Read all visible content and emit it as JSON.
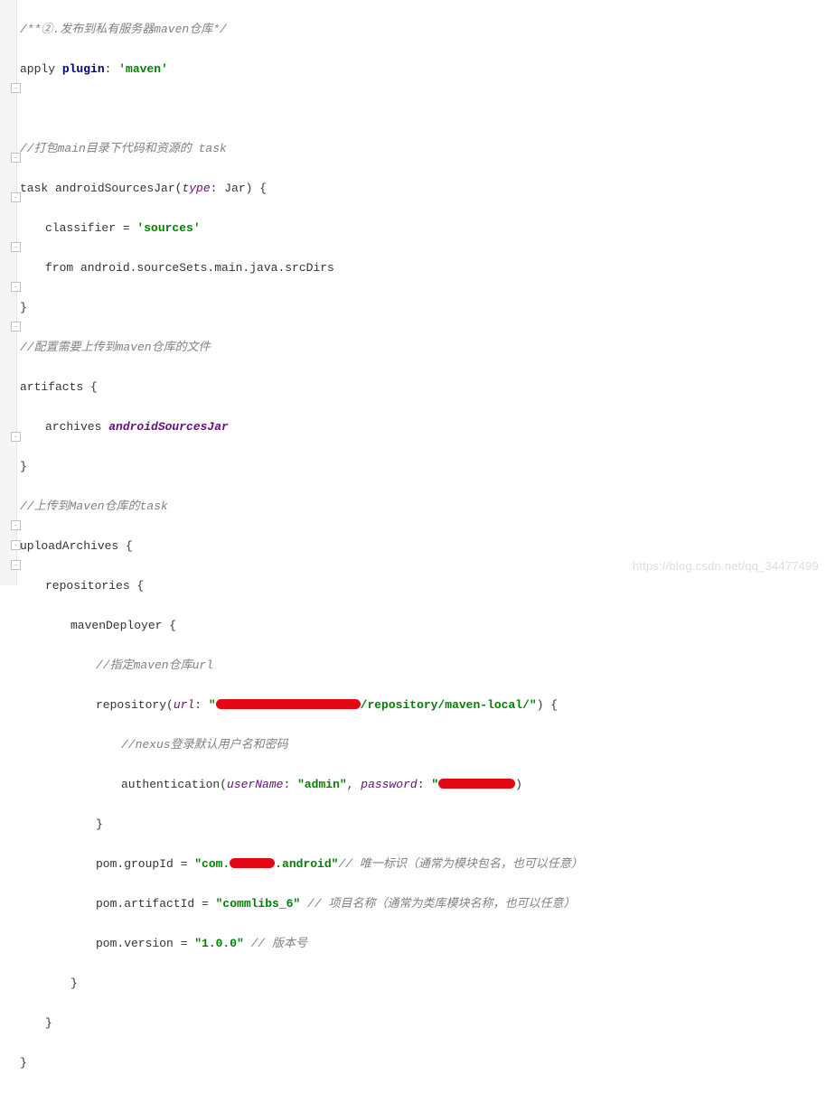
{
  "lines": {
    "l1_comment": "/**②.发布到私有服务器maven仓库*/",
    "l2_apply": "apply ",
    "l2_plugin": "plugin",
    "l2_colon": ": ",
    "l2_val": "'maven'",
    "l4_comment": "//打包main目录下代码和资源的 task",
    "l5_pre": "task androidSourcesJar(",
    "l5_type": "type",
    "l5_post": ": Jar) {",
    "l6_pre": "classifier = ",
    "l6_val": "'sources'",
    "l7": "from android.sourceSets.main.java.srcDirs",
    "l8": "}",
    "l9_comment": "//配置需要上传到maven仓库的文件",
    "l10": "artifacts {",
    "l11_pre": "archives ",
    "l11_val": "androidSourcesJar",
    "l12": "}",
    "l13_comment": "//上传到Maven仓库的task",
    "l14": "uploadArchives {",
    "l15": "repositories {",
    "l16": "mavenDeployer {",
    "l17_comment": "//指定maven仓库url",
    "l18_pre": "repository(",
    "l18_url": "url",
    "l18_mid": ": ",
    "l18_q1": "\"",
    "l18_after": "/repository/maven-local/\"",
    "l18_end": ") {",
    "l19_comment": "//nexus登录默认用户名和密码",
    "l20_pre": "authentication(",
    "l20_un": "userName",
    "l20_mid1": ": ",
    "l20_val1": "\"admin\"",
    "l20_comma": ", ",
    "l20_pw": "password",
    "l20_mid2": ": ",
    "l20_q2": "\"",
    "l20_close": ")",
    "l21": "}",
    "l22_pre": "pom.groupId = ",
    "l22_q": "\"com.",
    "l22_after": ".android\"",
    "l22_comment": "// 唯一标识（通常为模块包名，也可以任意）",
    "l23_pre": "pom.artifactId = ",
    "l23_val": "\"commlibs_6\"",
    "l23_comment": " // 项目名称（通常为类库模块名称，也可以任意）",
    "l24_pre": "pom.version = ",
    "l24_val": "\"1.0.0\"",
    "l24_comment": " // 版本号",
    "l25": "}",
    "l26": "}",
    "l27": "}"
  },
  "watermark": "https://blog.csdn.net/qq_34477499",
  "colors": {
    "comment": "#808080",
    "keyword": "#000080",
    "string": "#008000",
    "param": "#660E7A",
    "redact": "#e30613"
  }
}
